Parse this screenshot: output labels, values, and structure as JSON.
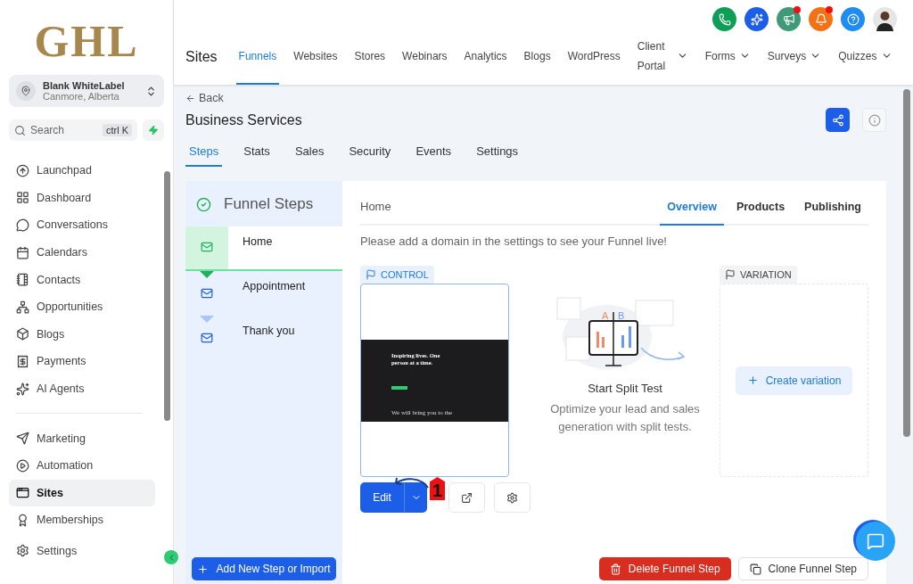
{
  "sidebar": {
    "logo": "GHL",
    "account": {
      "name": "Blank WhiteLabel",
      "location": "Canmore, Alberta"
    },
    "search": {
      "placeholder": "Search",
      "shortcut": "ctrl K"
    },
    "nav_primary": [
      {
        "label": "Launchpad",
        "selected": false
      },
      {
        "label": "Dashboard",
        "selected": false
      },
      {
        "label": "Conversations",
        "selected": false
      },
      {
        "label": "Calendars",
        "selected": false
      },
      {
        "label": "Contacts",
        "selected": false
      },
      {
        "label": "Opportunities",
        "selected": false
      },
      {
        "label": "Blogs",
        "selected": false
      },
      {
        "label": "Payments",
        "selected": false
      },
      {
        "label": "AI Agents",
        "selected": false
      }
    ],
    "nav_secondary": [
      {
        "label": "Marketing",
        "selected": false
      },
      {
        "label": "Automation",
        "selected": false
      },
      {
        "label": "Sites",
        "selected": true
      },
      {
        "label": "Memberships",
        "selected": false
      }
    ],
    "settings": "Settings"
  },
  "header": {
    "buttons": [
      {
        "color": "#0e9f57",
        "alert": false
      },
      {
        "color": "#1d5ee8",
        "alert": false
      },
      {
        "color": "#3f9a78",
        "alert": true
      },
      {
        "color": "#f47216",
        "alert": true
      },
      {
        "color": "#1e8cf0",
        "alert": false
      }
    ],
    "section": "Sites",
    "tabs": [
      {
        "label": "Funnels",
        "selected": true,
        "dropdown": false
      },
      {
        "label": "Websites",
        "selected": false,
        "dropdown": false
      },
      {
        "label": "Stores",
        "selected": false,
        "dropdown": false
      },
      {
        "label": "Webinars",
        "selected": false,
        "dropdown": false
      },
      {
        "label": "Analytics",
        "selected": false,
        "dropdown": false
      },
      {
        "label": "Blogs",
        "selected": false,
        "dropdown": false
      },
      {
        "label": "WordPress",
        "selected": false,
        "dropdown": false
      },
      {
        "label": "Client Portal",
        "selected": false,
        "dropdown": true
      },
      {
        "label": "Forms",
        "selected": false,
        "dropdown": true
      },
      {
        "label": "Surveys",
        "selected": false,
        "dropdown": true
      },
      {
        "label": "Quizzes",
        "selected": false,
        "dropdown": true
      }
    ]
  },
  "page": {
    "back": "Back",
    "title": "Business Services",
    "tabs": [
      {
        "label": "Steps",
        "selected": true
      },
      {
        "label": "Stats",
        "selected": false
      },
      {
        "label": "Sales",
        "selected": false
      },
      {
        "label": "Security",
        "selected": false
      },
      {
        "label": "Events",
        "selected": false
      },
      {
        "label": "Settings",
        "selected": false
      }
    ]
  },
  "steps": {
    "title": "Funnel Steps",
    "items": [
      {
        "label": "Home",
        "selected": true
      },
      {
        "label": "Appointment",
        "selected": false
      },
      {
        "label": "Thank you",
        "selected": false
      }
    ],
    "add_button": "Add New Step or Import"
  },
  "detail": {
    "step_name": "Home",
    "tabs": [
      {
        "label": "Overview",
        "selected": true
      },
      {
        "label": "Products",
        "selected": false
      },
      {
        "label": "Publishing",
        "selected": false
      }
    ],
    "notice": "Please add a domain in the settings to see your Funnel live!",
    "control": {
      "label": "CONTROL",
      "preview_headline": "Inspiring lives. One person at a time.",
      "preview_footer": "We will bring you to the",
      "edit": "Edit"
    },
    "annotation": "1",
    "split_test": {
      "labels": [
        "A",
        "B"
      ],
      "title": "Start Split Test",
      "text": "Optimize your lead and sales generation with split tests."
    },
    "variation": {
      "label": "VARIATION",
      "button": "Create variation"
    },
    "delete_button": "Delete Funnel Step",
    "clone_button": "Clone Funnel Step"
  }
}
